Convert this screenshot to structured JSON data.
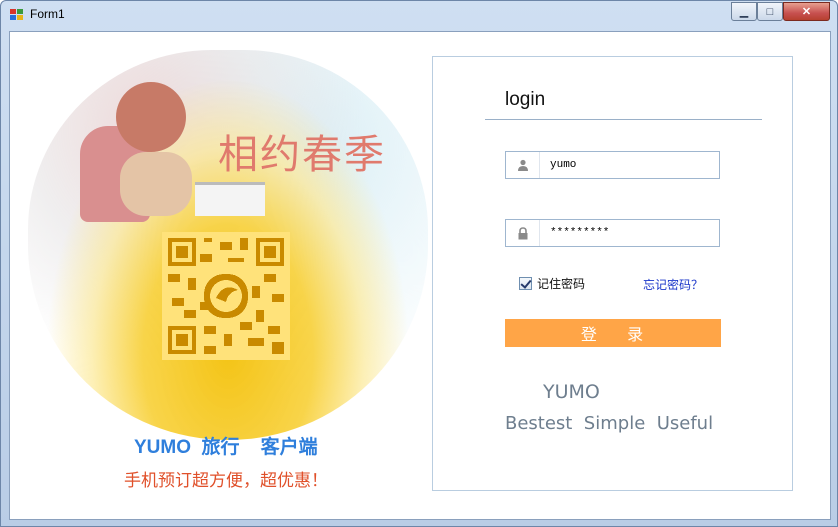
{
  "window": {
    "title": "Form1",
    "controls": {
      "minimize": "▁",
      "maximize": "□",
      "close": "✕"
    }
  },
  "promo": {
    "slogan": "相约春季",
    "client_title": "YUMO  旅行    客户端",
    "client_subtitle": "手机预订超方便，超优惠！",
    "qr_icon": "qr-code-icon"
  },
  "login": {
    "heading": "login",
    "username": {
      "value": "yumo",
      "icon": "user-icon"
    },
    "password": {
      "value": "*********",
      "icon": "lock-icon"
    },
    "remember_label": "记住密码",
    "remember_checked": true,
    "forgot_label": "忘记密码？",
    "submit_label": "登    录",
    "brand": "YUMO",
    "tagline": "Bestest  Simple  Useful"
  },
  "colors": {
    "accent_button": "#ffa547",
    "client_title": "#2f7fdc",
    "client_subtitle": "#e0502a",
    "forgot_link": "#1a35c9",
    "slogan": "#e07a6d",
    "qr_background": "#ffe27a"
  }
}
